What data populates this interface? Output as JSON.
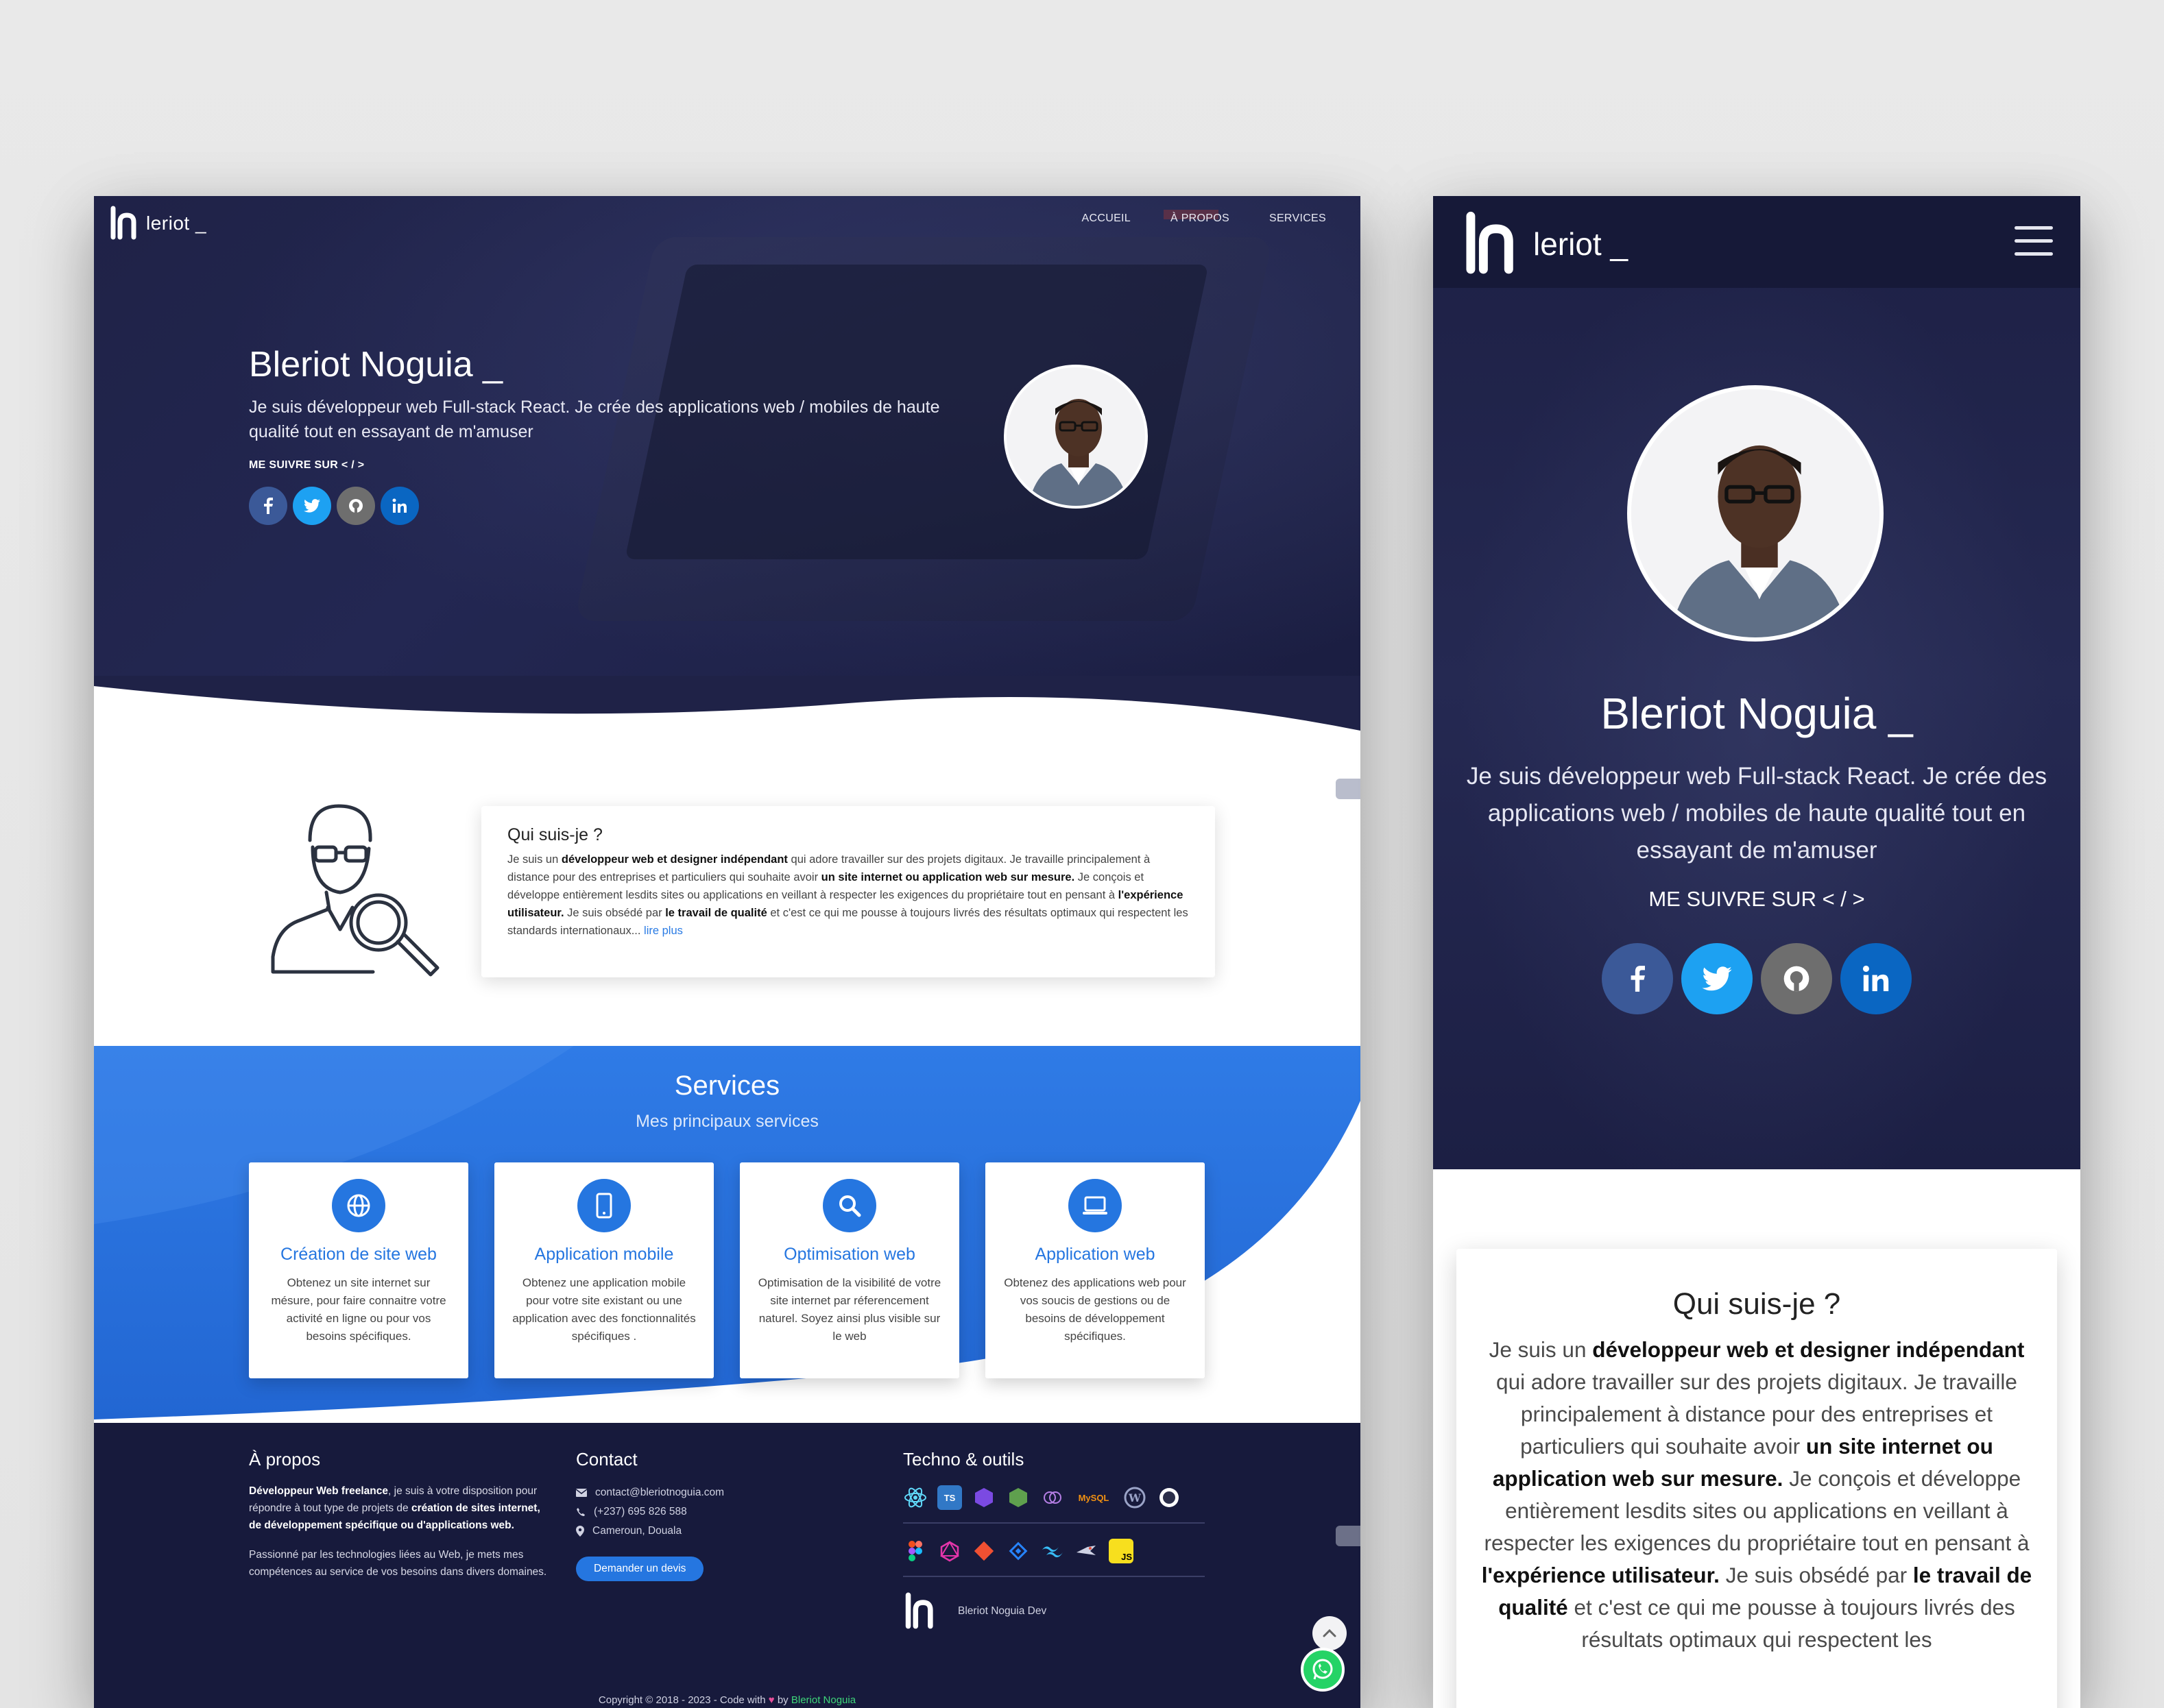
{
  "desktop": {
    "logo_text": "leriot _",
    "nav": [
      "ACCUEIL",
      "À PROPOS",
      "SERVICES"
    ],
    "hero": {
      "name": "Bleriot Noguia _",
      "description": "Je suis développeur web Full-stack React. Je crée des applications web / mobiles de haute qualité tout en essayant de m'amuser",
      "follow": "ME SUIVRE SUR < / >"
    },
    "about": {
      "title": "Qui suis-je ?",
      "p1": "Je suis un ",
      "b1": "développeur web et designer indépendant",
      "p2": " qui adore travailler sur des projets digitaux. Je travaille principalement à distance pour des entreprises et particuliers qui souhaite avoir ",
      "b2": "un site internet ou application web sur mesure.",
      "p3": " Je conçois et développe entièrement lesdits sites ou applications en veillant à respecter les exigences du propriétaire tout en pensant à ",
      "b3": "l'expérience utilisateur.",
      "p4": " Je suis obsédé par ",
      "b4": "le travail de qualité",
      "p5": " et c'est ce qui me pousse à toujours livrés des résultats optimaux qui respectent les standards internationaux... ",
      "more": "lire plus"
    },
    "services": {
      "title": "Services",
      "subtitle": "Mes principaux services",
      "items": [
        {
          "title": "Création de site web",
          "desc": "Obtenez un site internet sur mésure, pour faire connaitre votre activité en ligne ou pour vos besoins spécifiques.",
          "icon": "globe-icon"
        },
        {
          "title": "Application mobile",
          "desc": "Obtenez une application mobile pour votre site existant ou une application avec des fonctionnalités spécifiques .",
          "icon": "mobile-icon"
        },
        {
          "title": "Optimisation web",
          "desc": "Optimisation de la visibilité de votre site internet par réferencement naturel. Soyez ainsi plus visible sur le web",
          "icon": "search-icon"
        },
        {
          "title": "Application web",
          "desc": "Obtenez des applications web pour vos soucis de gestions ou de besoins de développement spécifiques.",
          "icon": "laptop-icon"
        }
      ]
    },
    "footer": {
      "about_title": "À propos",
      "about_b1": "Développeur Web freelance",
      "about_t1": ", je suis à votre disposition pour répondre à tout type de projets de ",
      "about_b2": "création de sites internet, de développement spécifique ou d'applications web.",
      "about_p2": "Passionné par les technologies liées au Web, je mets mes compétences au service de vos besoins dans divers domaines.",
      "contact_title": "Contact",
      "email": "contact@bleriotnoguia.com",
      "phone": "(+237) 695 826 588",
      "location": "Cameroun, Douala",
      "contact_button": "Demander un devis",
      "tech_title": "Techno & outils",
      "tech_row1": [
        "react-icon",
        "typescript-icon",
        "redux-icon",
        "nodejs-icon",
        "graphql-icon",
        "mysql-icon",
        "wordpress-icon",
        "globe-icon"
      ],
      "tech_row2": [
        "figma-icon",
        "graphql-icon",
        "git-icon",
        "jira-icon",
        "tailwind-icon",
        "bird-icon",
        "javascript-icon"
      ],
      "ts_label": "TS",
      "mysql_label": "MySQL",
      "js_label": "JS",
      "brand_text": "Bleriot Noguia Dev",
      "copyright_pre": "Copyright © 2018 - 2023 - Code with ",
      "copyright_by": " by ",
      "copyright_name": "Bleriot Noguia"
    }
  },
  "mobile": {
    "logo_text": "leriot _",
    "hero": {
      "name": "Bleriot Noguia _",
      "description": "Je suis développeur web Full-stack React. Je crée des applications web / mobiles de haute qualité tout en essayant de m'amuser",
      "follow": "ME SUIVRE SUR < / >"
    },
    "about": {
      "title": "Qui suis-je ?",
      "p1": "Je suis un ",
      "b1": "développeur web et designer indépendant",
      "p2": " qui adore travailler sur des projets digitaux. Je travaille principalement à distance pour des entreprises et particuliers qui souhaite avoir ",
      "b2": "un site internet ou application web sur mesure.",
      "p3": " Je conçois et développe entièrement lesdits sites ou applications en veillant à respecter les exigences du propriétaire tout en pensant à ",
      "b3": "l'expérience utilisateur.",
      "p4": " Je suis obsédé par ",
      "b4": "le travail de qualité",
      "p5": " et c'est ce qui me pousse à toujours livrés des résultats optimaux qui respectent les"
    }
  },
  "colors": {
    "navy": "#1f2247",
    "blue": "#2576e0",
    "footer": "#171a3c",
    "facebook": "#3b5998",
    "twitter": "#1da1f2",
    "github": "#6e6e6e",
    "linkedin": "#0a66c2"
  }
}
